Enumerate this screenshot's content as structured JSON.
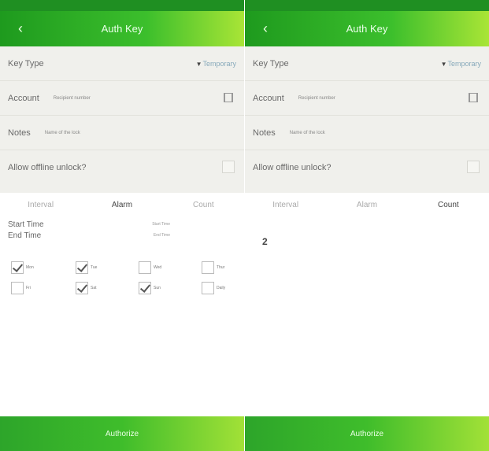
{
  "left": {
    "title": "Auth Key",
    "key_type_label": "Key Type",
    "key_type_value": "Temporary",
    "account_label": "Account",
    "account_placeholder": "Recipient number",
    "notes_label": "Notes",
    "notes_placeholder": "Name of the lock",
    "allow_offline_label": "Allow offline unlock?",
    "allow_offline_checked": false,
    "tabs": [
      {
        "label": "Interval",
        "active": false
      },
      {
        "label": "Alarm",
        "active": true
      },
      {
        "label": "Count",
        "active": false
      }
    ],
    "start_time_label": "Start Time",
    "start_time_value": "Start Time",
    "end_time_label": "End Time",
    "end_time_value": "End Time",
    "days": [
      {
        "label": "Mon",
        "checked": true
      },
      {
        "label": "Tue",
        "checked": true
      },
      {
        "label": "Wed",
        "checked": false
      },
      {
        "label": "Thur",
        "checked": false
      },
      {
        "label": "Fri",
        "checked": false
      },
      {
        "label": "Sat",
        "checked": true
      },
      {
        "label": "Sun",
        "checked": true
      },
      {
        "label": "Daily",
        "checked": false
      }
    ],
    "authorize_label": "Authorize"
  },
  "right": {
    "title": "Auth Key",
    "key_type_label": "Key Type",
    "key_type_value": "Temporary",
    "account_label": "Account",
    "account_placeholder": "Recipient number",
    "notes_label": "Notes",
    "notes_placeholder": "Name of the lock",
    "allow_offline_label": "Allow offline unlock?",
    "allow_offline_checked": false,
    "tabs": [
      {
        "label": "Interval",
        "active": false
      },
      {
        "label": "Alarm",
        "active": false
      },
      {
        "label": "Count",
        "active": true
      }
    ],
    "count_value": "2",
    "authorize_label": "Authorize"
  },
  "colors": {
    "header_green": "#1e9a1e",
    "accent_lime": "#a9e536",
    "form_bg": "#f0f0ec"
  }
}
